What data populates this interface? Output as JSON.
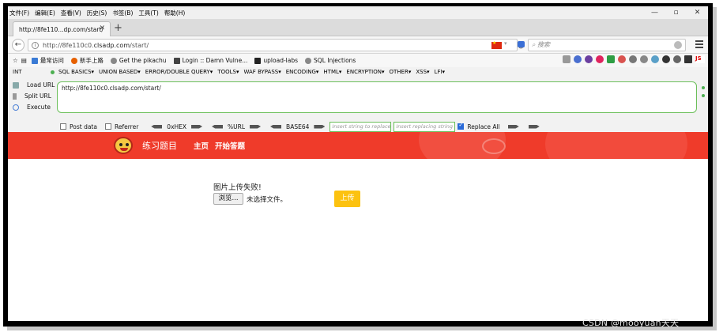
{
  "menubar": [
    "文件(F)",
    "编辑(E)",
    "查看(V)",
    "历史(S)",
    "书签(B)",
    "工具(T)",
    "帮助(H)"
  ],
  "window_controls": {
    "minimize": "—",
    "maximize": "▫",
    "close": "✕"
  },
  "tab": {
    "title": "http://8fe110...dp.com/start/",
    "close": "✕",
    "new": "+"
  },
  "address": {
    "prefix": "http://8fe110c0.",
    "host": "clsadp.com",
    "suffix": "/start/",
    "reload": "↻"
  },
  "search": {
    "placeholder": "搜索"
  },
  "bookmarks": [
    {
      "label": "最常访问",
      "icon": "folder-icon",
      "color": "#3a7bd5"
    },
    {
      "label": "新手上路",
      "icon": "firefox-icon",
      "color": "#e66000"
    },
    {
      "label": "Get the pikachu",
      "icon": "globe-icon",
      "color": "#888888"
    },
    {
      "label": "Login :: Damn Vulne...",
      "icon": "dvwa-icon",
      "color": "#444444"
    },
    {
      "label": "upload-labs",
      "icon": "folder-dark-icon",
      "color": "#222222"
    },
    {
      "label": "SQL Injections",
      "icon": "globe-icon",
      "color": "#888888"
    }
  ],
  "hackbar": {
    "int_label": "INT",
    "menus": [
      "SQL BASICS▾",
      "UNION BASED▾",
      "ERROR/DOUBLE QUERY▾",
      "TOOLS▾",
      "WAF BYPASS▾",
      "ENCODING▾",
      "HTML▾",
      "ENCRYPTION▾",
      "OTHER▾",
      "XSS▾",
      "LFI▾"
    ],
    "load_url": "Load URL",
    "split_url": "Split URL",
    "execute": "Execute",
    "url_value": "http://8fe110c0.clsadp.com/start/",
    "post_data": "Post data",
    "referrer": "Referrer",
    "hex": "0xHEX",
    "url_enc": "%URL",
    "base64": "BASE64",
    "insert_placeholder": "Insert string to replace",
    "replace_placeholder": "Insert replacing string",
    "replace_all": "Replace All"
  },
  "site": {
    "brand": "练习题目",
    "nav": [
      "主页",
      "开始答题"
    ],
    "accent": "#ef3b2a",
    "message": "图片上传失败!",
    "browse": "浏览...",
    "no_file": "未选择文件。",
    "upload": "上传",
    "upload_color": "#fcc210"
  },
  "watermark": "CSDN @mooyuan天天"
}
